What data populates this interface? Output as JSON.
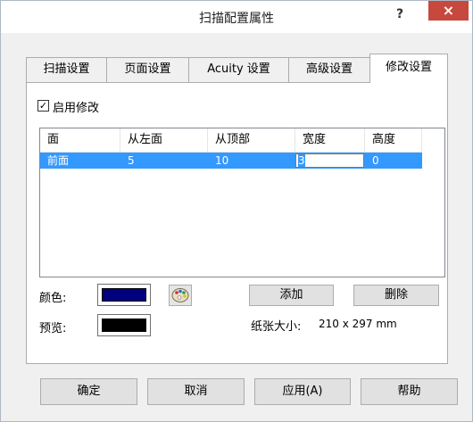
{
  "window": {
    "title": "扫描配置属性",
    "help_label": "?",
    "close_label": "×"
  },
  "tabs": [
    {
      "label": "扫描设置"
    },
    {
      "label": "页面设置"
    },
    {
      "label": "Acuity 设置"
    },
    {
      "label": "高级设置"
    },
    {
      "label": "修改设置"
    }
  ],
  "enable": {
    "label": "启用修改",
    "checked": true,
    "check_mark": "✓"
  },
  "grid": {
    "columns": [
      "面",
      "从左面",
      "从顶部",
      "宽度",
      "高度"
    ],
    "rows": [
      {
        "face": "前面",
        "left": "5",
        "top": "10",
        "width": "3",
        "height": "0"
      }
    ]
  },
  "color": {
    "label": "颜色:",
    "value": "#00007f"
  },
  "preview": {
    "label": "预览:",
    "value": "#000000"
  },
  "icons": {
    "palette": "palette-icon"
  },
  "actions": {
    "add_label": "添加",
    "delete_label": "删除"
  },
  "paper": {
    "label": "纸张大小:",
    "value": "210 x 297 mm"
  },
  "footer": {
    "ok_label": "确定",
    "cancel_label": "取消",
    "apply_label": "应用(A)",
    "help_label": "帮助"
  },
  "colors": {
    "accent": "#3399ff",
    "close": "#c7483d"
  }
}
